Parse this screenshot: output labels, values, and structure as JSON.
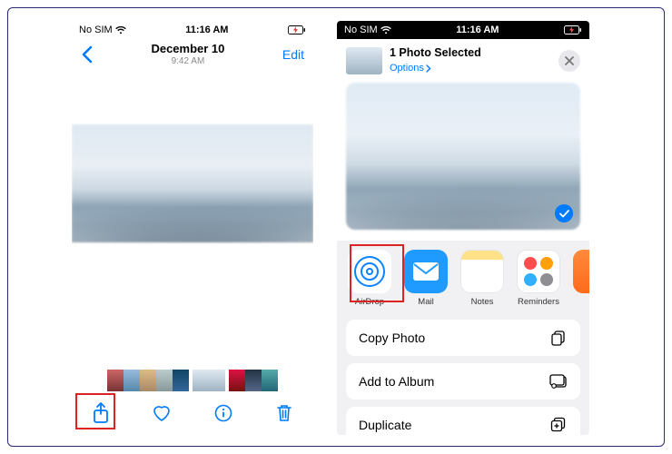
{
  "status": {
    "carrier": "No SIM",
    "time": "11:16 AM"
  },
  "left": {
    "date": "December 10",
    "subtime": "9:42 AM",
    "edit": "Edit"
  },
  "right": {
    "selected_title": "1 Photo Selected",
    "options": "Options",
    "apps": {
      "airdrop": "AirDrop",
      "mail": "Mail",
      "notes": "Notes",
      "reminders": "Reminders"
    },
    "actions": {
      "copy": "Copy Photo",
      "add_album": "Add to Album",
      "duplicate": "Duplicate"
    }
  }
}
